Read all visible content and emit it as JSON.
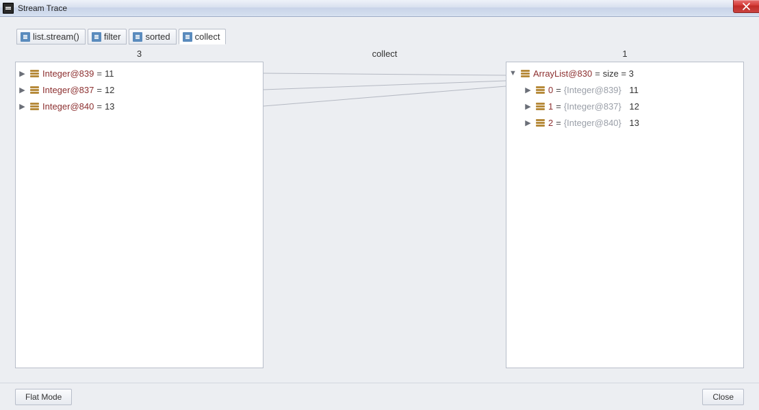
{
  "window": {
    "title": "Stream Trace",
    "close_icon": "close-icon"
  },
  "tabs": [
    {
      "label": "list.stream()",
      "active": false
    },
    {
      "label": "filter",
      "active": false
    },
    {
      "label": "sorted",
      "active": false
    },
    {
      "label": "collect",
      "active": true
    }
  ],
  "columns": {
    "left_header": "3",
    "center_header": "collect",
    "right_header": "1"
  },
  "left_panel": {
    "items": [
      {
        "ref": "Integer@839",
        "value": "11"
      },
      {
        "ref": "Integer@837",
        "value": "12"
      },
      {
        "ref": "Integer@840",
        "value": "13"
      }
    ]
  },
  "right_panel": {
    "root": {
      "ref": "ArrayList@830",
      "size_label": "size = 3"
    },
    "children": [
      {
        "index": "0",
        "detail": "{Integer@839}",
        "value": "11"
      },
      {
        "index": "1",
        "detail": "{Integer@837}",
        "value": "12"
      },
      {
        "index": "2",
        "detail": "{Integer@840}",
        "value": "13"
      }
    ]
  },
  "footer": {
    "flat_mode": "Flat Mode",
    "close": "Close"
  },
  "glyphs": {
    "eq": " = "
  }
}
